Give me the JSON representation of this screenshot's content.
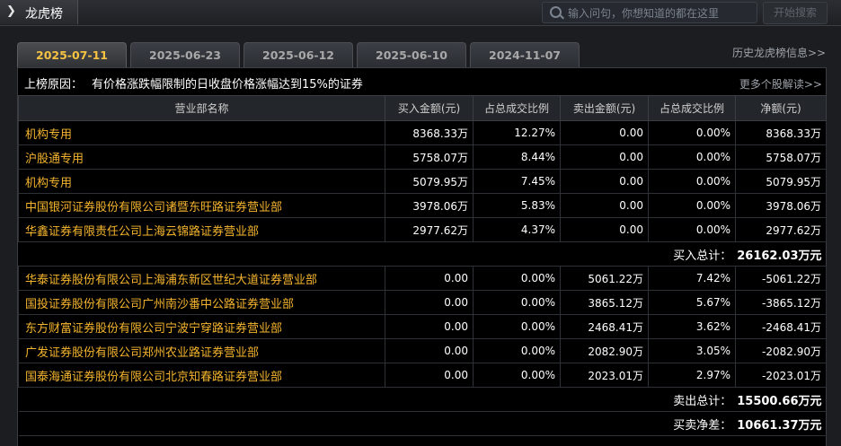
{
  "header": {
    "title": "龙虎榜",
    "search_placeholder": "输入问句，你想知道的都在这里",
    "search_button": "开始搜索"
  },
  "tabs": [
    {
      "label": "2025-07-11",
      "active": true
    },
    {
      "label": "2025-06-23",
      "active": false
    },
    {
      "label": "2025-06-12",
      "active": false
    },
    {
      "label": "2025-06-10",
      "active": false
    },
    {
      "label": "2024-11-07",
      "active": false
    }
  ],
  "history_link": "历史龙虎榜信息>>",
  "reason": {
    "label": "上榜原因：",
    "text": "有价格涨跌幅限制的日收盘价格涨幅达到15%的证券",
    "more_link": "更多个股解读>>"
  },
  "columns": [
    "营业部名称",
    "买入金额(元)",
    "占总成交比例",
    "卖出金额(元)",
    "占总成交比例",
    "净额(元)"
  ],
  "buy_rows": [
    [
      "机构专用",
      "8368.33万",
      "12.27%",
      "0.00",
      "0.00%",
      "8368.33万"
    ],
    [
      "沪股通专用",
      "5758.07万",
      "8.44%",
      "0.00",
      "0.00%",
      "5758.07万"
    ],
    [
      "机构专用",
      "5079.95万",
      "7.45%",
      "0.00",
      "0.00%",
      "5079.95万"
    ],
    [
      "中国银河证券股份有限公司诸暨东旺路证券营业部",
      "3978.06万",
      "5.83%",
      "0.00",
      "0.00%",
      "3978.06万"
    ],
    [
      "华鑫证券有限责任公司上海云锦路证券营业部",
      "2977.62万",
      "4.37%",
      "0.00",
      "0.00%",
      "2977.62万"
    ]
  ],
  "buy_total": {
    "label": "买入总计：",
    "value": "26162.03万元"
  },
  "sell_rows": [
    [
      "华泰证券股份有限公司上海浦东新区世纪大道证券营业部",
      "0.00",
      "0.00%",
      "5061.22万",
      "7.42%",
      "-5061.22万"
    ],
    [
      "国投证券股份有限公司广州南沙番中公路证券营业部",
      "0.00",
      "0.00%",
      "3865.12万",
      "5.67%",
      "-3865.12万"
    ],
    [
      "东方财富证券股份有限公司宁波宁穿路证券营业部",
      "0.00",
      "0.00%",
      "2468.41万",
      "3.62%",
      "-2468.41万"
    ],
    [
      "广发证券股份有限公司郑州农业路证券营业部",
      "0.00",
      "0.00%",
      "2082.90万",
      "3.05%",
      "-2082.90万"
    ],
    [
      "国泰海通证券股份有限公司北京知春路证券营业部",
      "0.00",
      "0.00%",
      "2023.01万",
      "2.97%",
      "-2023.01万"
    ]
  ],
  "sell_total": {
    "label": "卖出总计：",
    "value": "15500.66万元"
  },
  "net_total": {
    "label": "买卖净差：",
    "value": "10661.37万元"
  }
}
